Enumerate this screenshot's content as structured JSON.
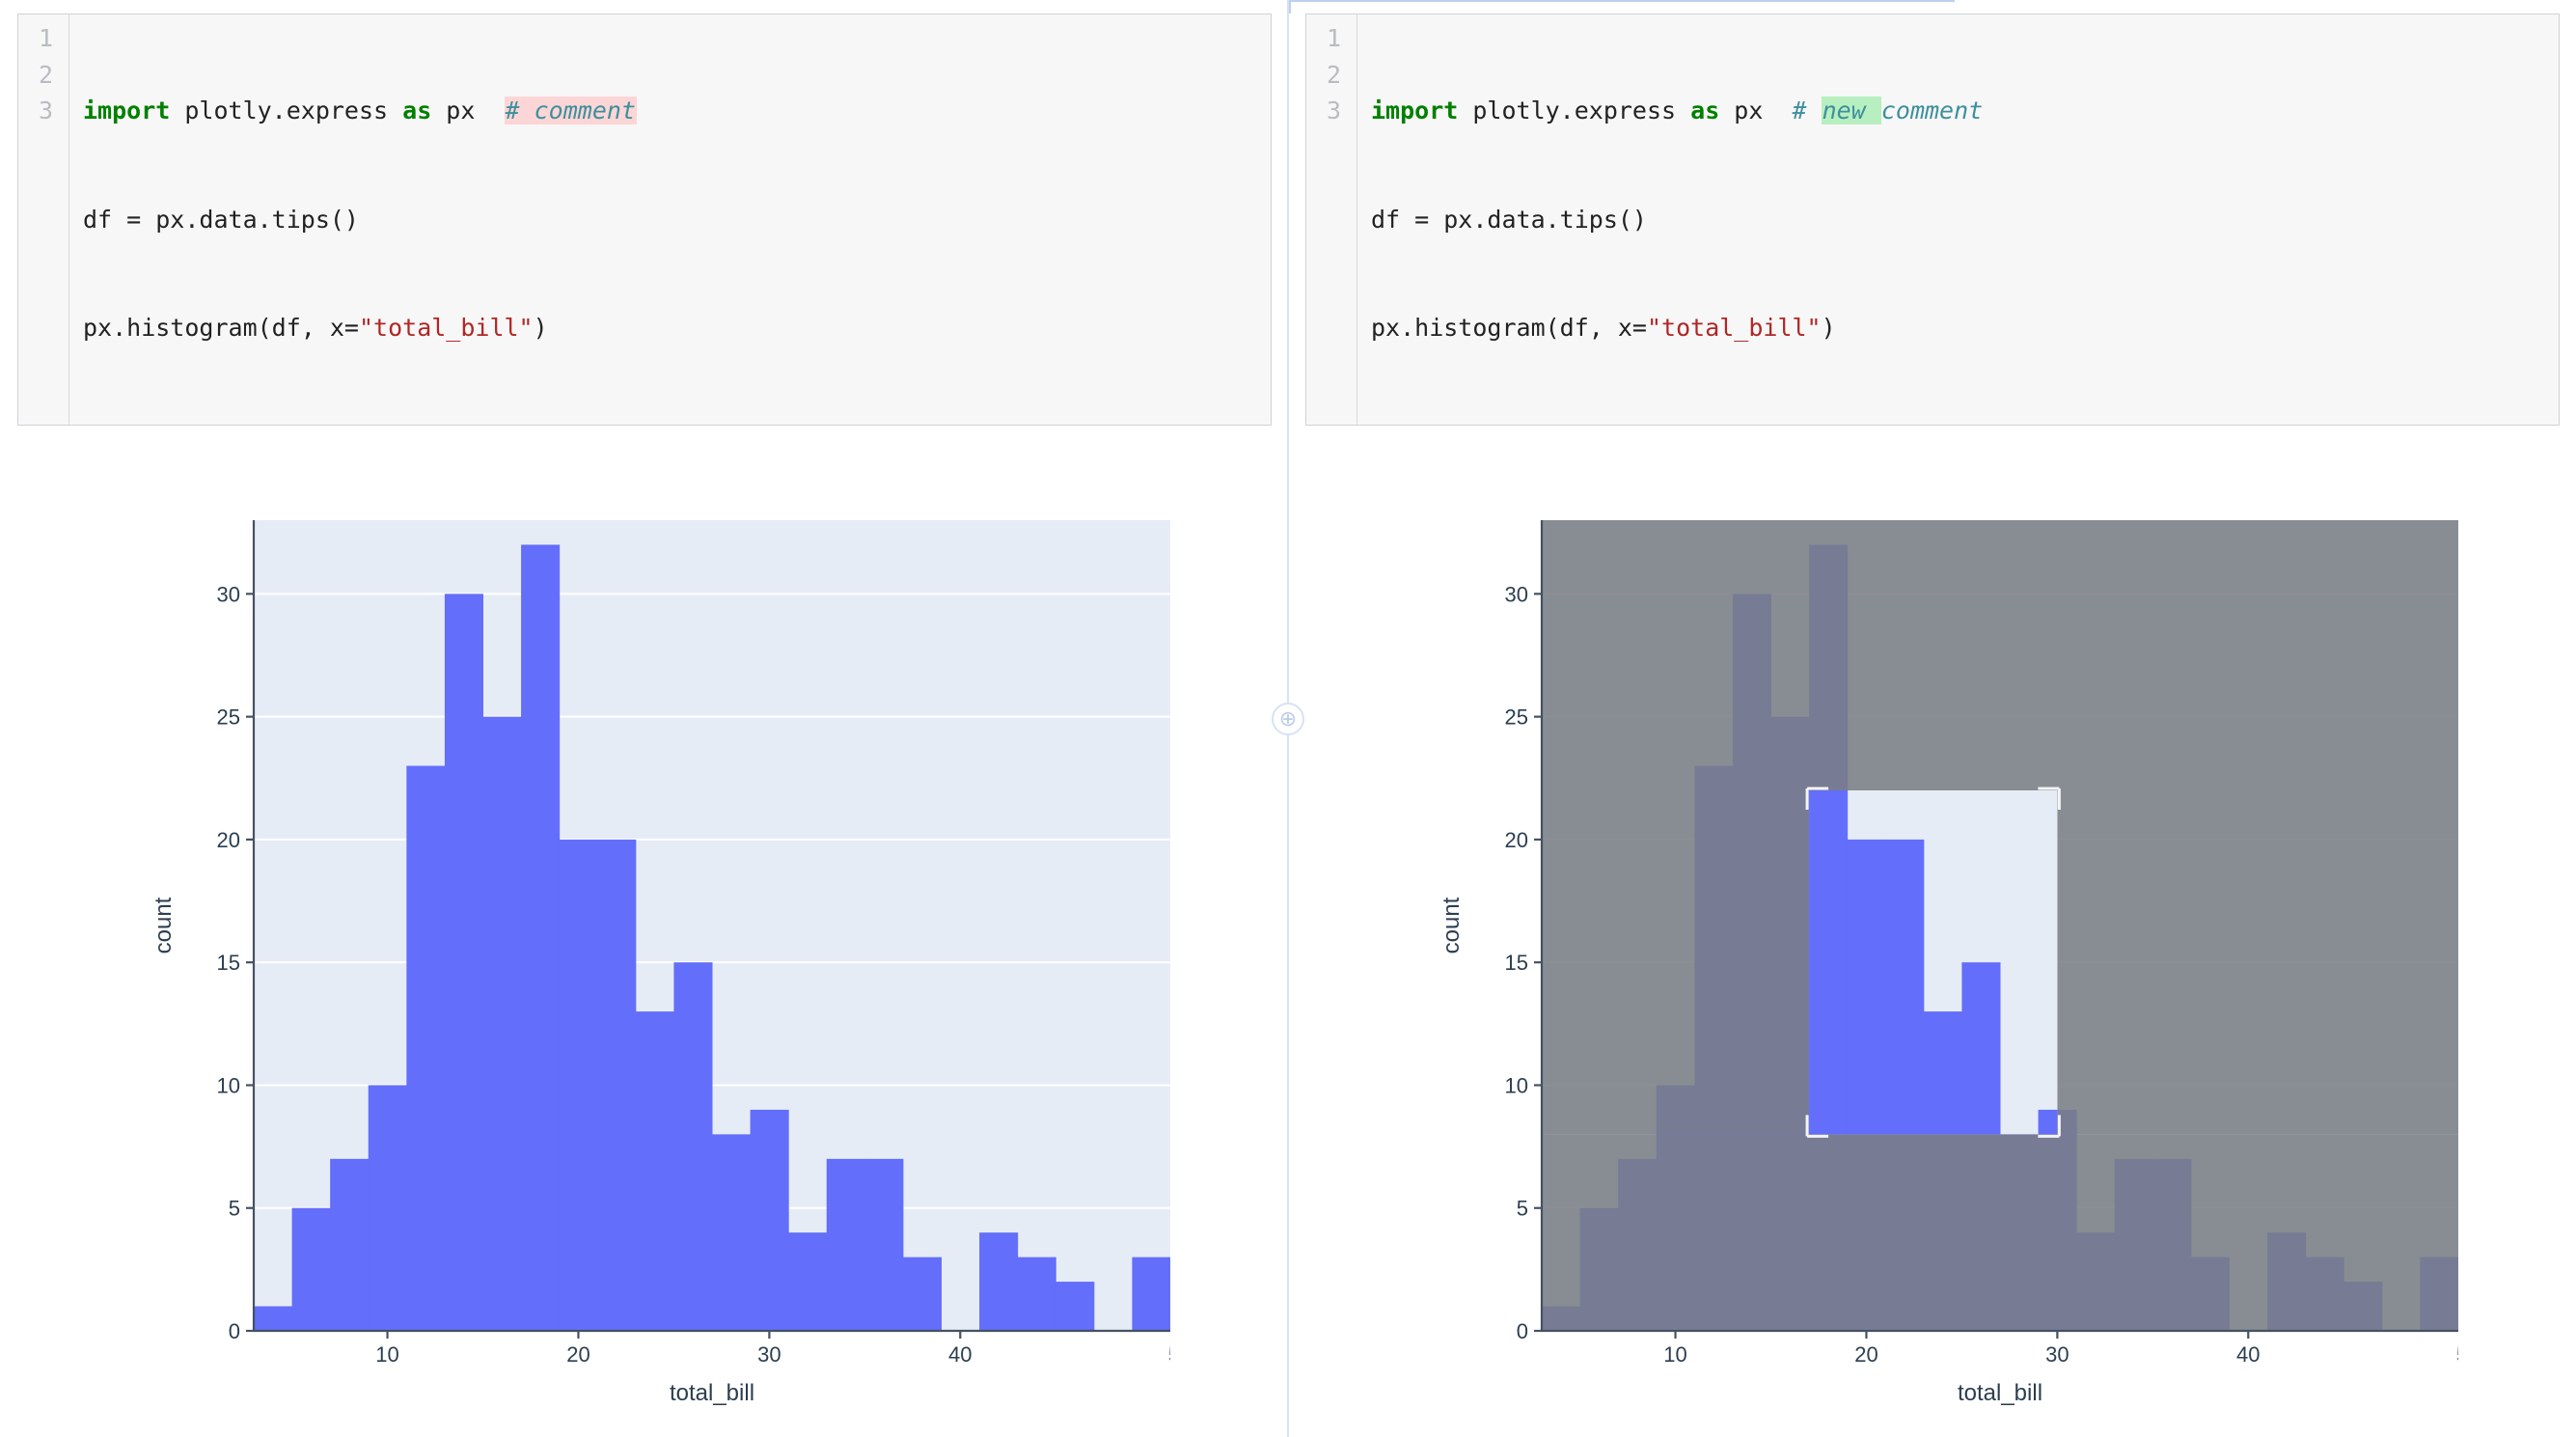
{
  "colors": {
    "bar": "#636efa",
    "plot_bg": "#e6ecf6",
    "axis": "#2c3e50"
  },
  "left": {
    "code": {
      "line_numbers": [
        "1",
        "2",
        "3"
      ],
      "l1_kw1": "import",
      "l1_mod": " plotly.express ",
      "l1_kw2": "as",
      "l1_alias": " px  ",
      "l1_comment_full": "# comment",
      "l2": "df = px.data.tips()",
      "l3_pre": "px.histogram(df, x=",
      "l3_str": "\"total_bill\"",
      "l3_post": ")"
    }
  },
  "right": {
    "code": {
      "line_numbers": [
        "1",
        "2",
        "3"
      ],
      "l1_kw1": "import",
      "l1_mod": " plotly.express ",
      "l1_kw2": "as",
      "l1_alias": " px  ",
      "l1_comment_pre": "# ",
      "l1_comment_ins": "new ",
      "l1_comment_post": "comment",
      "l2": "df = px.data.tips()",
      "l3_pre": "px.histogram(df, x=",
      "l3_str": "\"total_bill\"",
      "l3_post": ")"
    },
    "selection": {
      "x0_data": 17,
      "x1_data": 30,
      "y0_count": 8,
      "y1_count": 22
    }
  },
  "chart_data": {
    "type": "bar",
    "title": "",
    "xlabel": "total_bill",
    "ylabel": "count",
    "x_start": 3,
    "bin_width": 2,
    "values": [
      1,
      5,
      7,
      10,
      23,
      30,
      25,
      32,
      20,
      20,
      13,
      15,
      8,
      9,
      4,
      7,
      7,
      3,
      0,
      4,
      3,
      2,
      0,
      3
    ],
    "ylim": [
      0,
      33
    ],
    "y_ticks": [
      0,
      5,
      10,
      15,
      20,
      25,
      30
    ],
    "x_ticks": [
      10,
      20,
      30,
      40
    ]
  }
}
